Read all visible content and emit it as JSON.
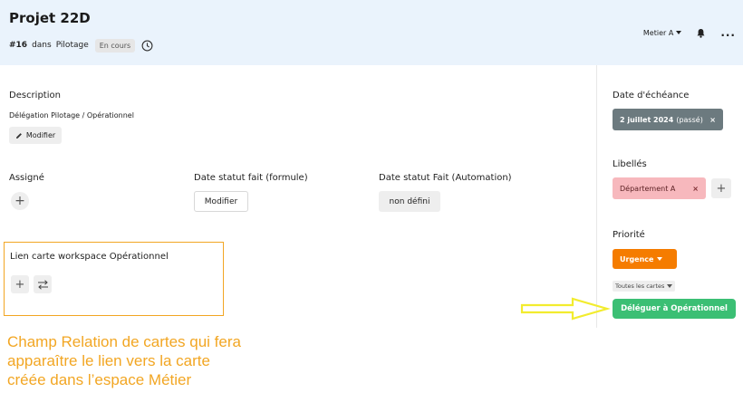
{
  "header": {
    "title": "Projet 22D",
    "card_number": "#16",
    "in_text": "dans",
    "board": "Pilotage",
    "status": "En cours",
    "workspace_selector": "Metier A",
    "more": "..."
  },
  "description": {
    "label": "Description",
    "text": "Délégation Pilotage / Opérationnel",
    "edit_label": "Modifier"
  },
  "fields": {
    "assignee_label": "Assigné",
    "date_formula_label": "Date statut fait (formule)",
    "date_formula_button": "Modifier",
    "date_automation_label": "Date statut Fait (Automation)",
    "date_automation_value": "non défini"
  },
  "link_field": {
    "label": "Lien carte workspace Opérationnel"
  },
  "sidebar": {
    "due_label": "Date d'échéance",
    "due_date": "2 juillet 2024",
    "due_state": "(passé)",
    "labels_label": "Libellés",
    "label_chip": "Département A",
    "priority_label": "Priorité",
    "priority_value": "Urgence",
    "scope_select": "Toutes les cartes",
    "delegate_button": "Déléguer à Opérationnel"
  },
  "annotation": {
    "line1": "Champ Relation de cartes qui fera",
    "line2": "apparaître le lien vers la carte",
    "line3": "créée dans l’espace Métier"
  },
  "colors": {
    "header_bg": "#eaf3fc",
    "annotation": "#f2a623",
    "due_chip": "#6c7a7f",
    "label_chip": "#f7b8bd",
    "priority": "#f57c00",
    "delegate": "#3bbf74"
  }
}
